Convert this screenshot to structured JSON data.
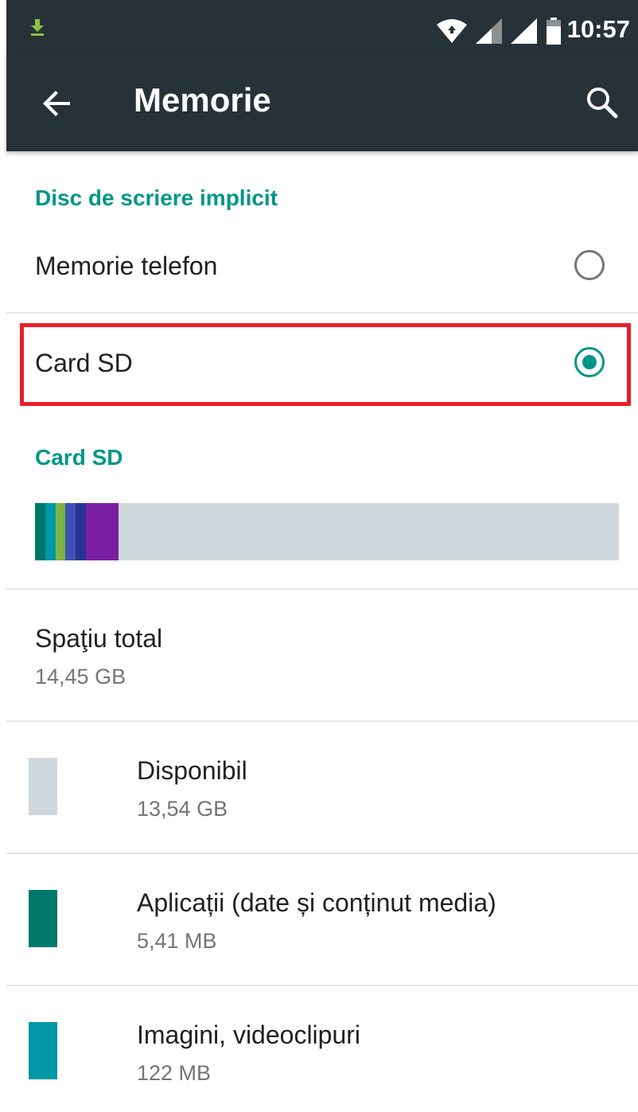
{
  "status_bar": {
    "time": "10:57",
    "icons": [
      "download-icon",
      "wifi-icon",
      "signal-icon-1",
      "signal-icon-2",
      "battery-icon"
    ]
  },
  "app_bar": {
    "title": "Memorie",
    "back_icon": "back-arrow-icon",
    "search_icon": "search-icon"
  },
  "default_disk": {
    "header": "Disc de scriere implicit",
    "options": [
      {
        "label": "Memorie telefon",
        "selected": false
      },
      {
        "label": "Card SD",
        "selected": true
      }
    ]
  },
  "card_sd": {
    "header": "Card SD",
    "bar_segments": [
      {
        "color": "#00796b",
        "fraction": 0.018
      },
      {
        "color": "#0097a7",
        "fraction": 0.018
      },
      {
        "color": "#7cb342",
        "fraction": 0.017
      },
      {
        "color": "#3f51b5",
        "fraction": 0.018
      },
      {
        "color": "#283593",
        "fraction": 0.018
      },
      {
        "color": "#7b1fa2",
        "fraction": 0.056
      }
    ],
    "bar_background": "#cfd8dc",
    "total": {
      "title": "Spaţiu total",
      "value": "14,45 GB"
    },
    "items": [
      {
        "title": "Disponibil",
        "value": "13,54 GB",
        "color": "#cfd8dc"
      },
      {
        "title": "Aplicații (date și conținut media)",
        "value": "5,41 MB",
        "color": "#00796b"
      },
      {
        "title": "Imagini, videoclipuri",
        "value": "122 MB",
        "color": "#0097a7"
      }
    ]
  },
  "colors": {
    "accent": "#009688",
    "toolbar": "#263238",
    "highlight": "#e8202a"
  }
}
